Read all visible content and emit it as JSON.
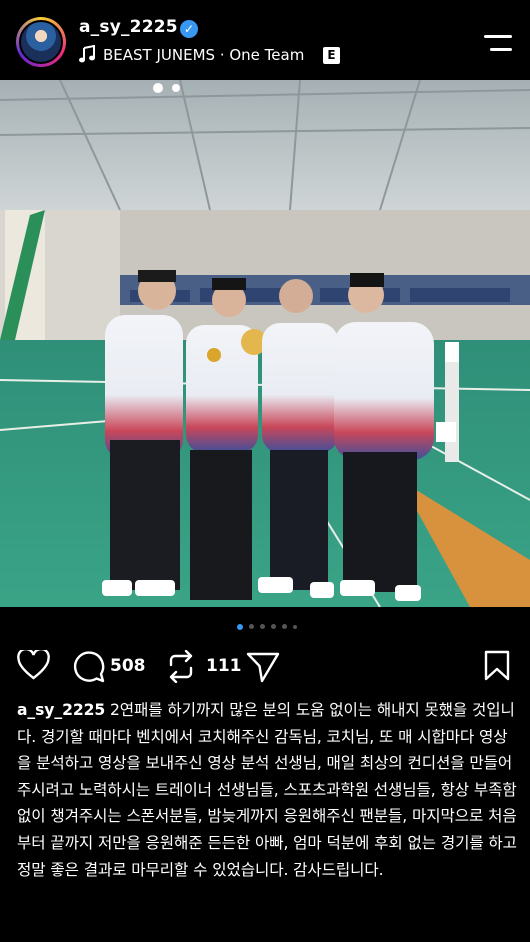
{
  "post": {
    "username": "a_sy_2225",
    "music_title": "BEAST JUNEMS · One Team",
    "explicit_badge": "E",
    "like_icon": "heart-icon",
    "comment_count": "508",
    "repost_count": "111",
    "caption": "2연패를 하기까지 많은 분의 도움 없이는 해내지 못했을 것입니다. 경기할 때마다 벤치에서 코치해주신 감독님, 코치님, 또 매 시합마다 영상을 분석하고 영상을 보내주신 영상 분석 선생님, 매일 최상의 컨디션을 만들어주시려고 노력하시는 트레이너 선생님들, 스포츠과학원 선생님들, 항상 부족함 없이 챙겨주시는 스폰서분들, 밤늦게까지 응원해주신 팬분들, 마지막으로 처음부터 끝까지 저만을 응원해준 든든한 아빠, 엄마 덕분에 후회 없는 경기를 하고 정말 좋은 결과로 마무리할 수 있었습니다. 감사드립니다."
  },
  "carousel": {
    "total": 6,
    "active_index": 0
  },
  "colors": {
    "background": "#000000",
    "verified": "#3897f0",
    "active_dot": "#3897f0",
    "inactive_dot": "#555555"
  }
}
